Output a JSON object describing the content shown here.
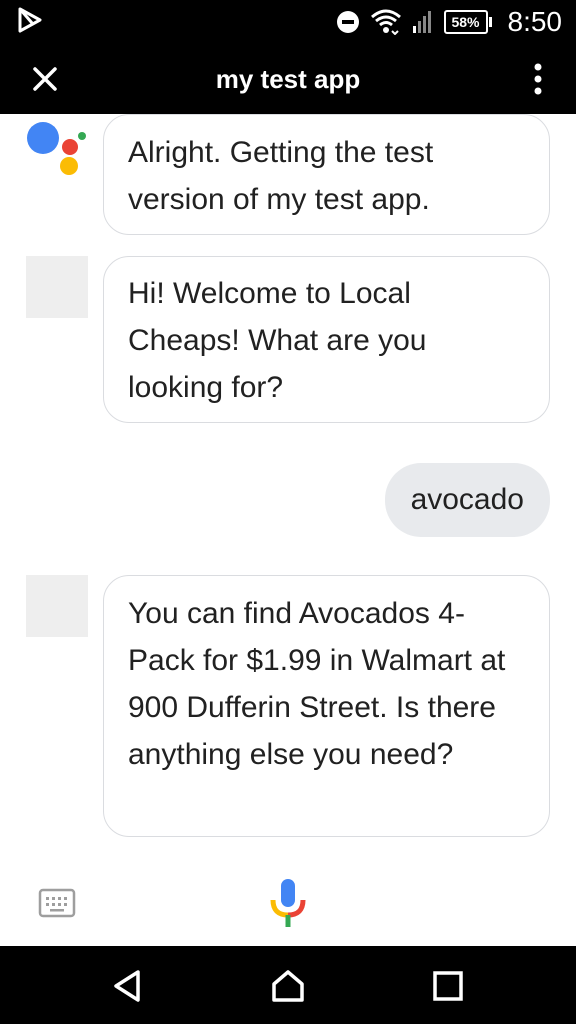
{
  "status_bar": {
    "left_icon": "play-store-notification-icon",
    "dnd_icon": "do-not-disturb-icon",
    "wifi_icon": "wifi-icon",
    "signal_icon": "cell-signal-icon",
    "battery": "58%",
    "time": "8:50"
  },
  "app_bar": {
    "close_icon": "close-icon",
    "title": "my test app",
    "more_icon": "more-vert-icon"
  },
  "messages": [
    {
      "sender": "assistant",
      "avatar": "google-assistant-logo",
      "text": "Alright. Getting the test version of my test app."
    },
    {
      "sender": "app",
      "avatar": "blank-avatar",
      "text": "Hi! Welcome to Local Cheaps! What are you looking for?"
    },
    {
      "sender": "user",
      "text": "avocado"
    },
    {
      "sender": "app",
      "avatar": "blank-avatar",
      "text": "You can find Avocados 4-Pack for $1.99 in Walmart at 900 Dufferin Street. Is there anything else you need?"
    }
  ],
  "input_bar": {
    "keyboard_icon": "keyboard-icon",
    "mic_icon": "microphone-icon"
  },
  "nav_bar": {
    "back_icon": "back-icon",
    "home_icon": "home-icon",
    "recents_icon": "recents-icon"
  },
  "colors": {
    "bar_background": "#000000",
    "bubble_border": "#dadce0",
    "user_bubble": "#e8eaed",
    "google_blue": "#4285f4",
    "google_red": "#ea4335",
    "google_yellow": "#fbbc04",
    "google_green": "#34a853"
  }
}
